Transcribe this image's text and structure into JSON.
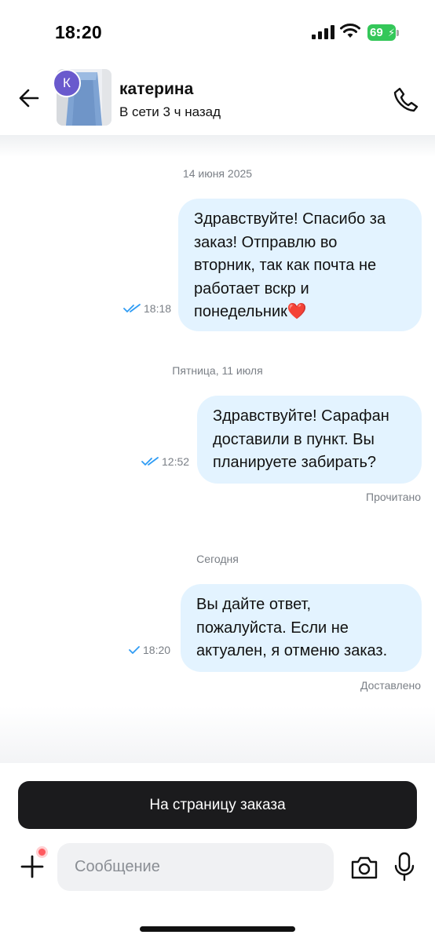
{
  "status_bar": {
    "time": "18:20",
    "battery": "69",
    "icons": [
      "signal-icon",
      "wifi-icon",
      "battery-icon"
    ]
  },
  "header": {
    "contact_name": "катерина",
    "contact_status": "В сети 3 ч назад",
    "avatar_initial": "К",
    "icons": [
      "back-arrow-icon",
      "phone-icon"
    ]
  },
  "chat": {
    "groups": [
      {
        "date": "14 июня 2025",
        "message": {
          "lines": [
            "Здравствуйте! Спасибо за",
            "заказ! Отправлю во",
            "вторник, так как почта не",
            "работает вскр и",
            "понедельник❤️"
          ],
          "time": "18:18",
          "status": ""
        }
      },
      {
        "date": "Пятница, 11 июля",
        "message": {
          "lines": [
            "Здравствуйте! Сарафан",
            "доставили в пункт. Вы",
            "планируете забирать?"
          ],
          "time": "12:52",
          "status": "Прочитано"
        }
      },
      {
        "date": "Сегодня",
        "message": {
          "lines": [
            "Вы дайте ответ,",
            "пожалуйста. Если не",
            "актуален, я отменю заказ."
          ],
          "time": "18:20",
          "status": "Доставлено"
        }
      }
    ]
  },
  "bottom": {
    "order_button_label": "На страницу заказа",
    "input_placeholder": "Сообщение",
    "icons": [
      "plus-icon",
      "camera-icon",
      "microphone-icon"
    ]
  },
  "colors": {
    "bubble": "#e3f3ff",
    "check": "#2f9cf4",
    "battery": "#34c759",
    "button": "#1b1b1d",
    "badge": "#6a5acd"
  }
}
